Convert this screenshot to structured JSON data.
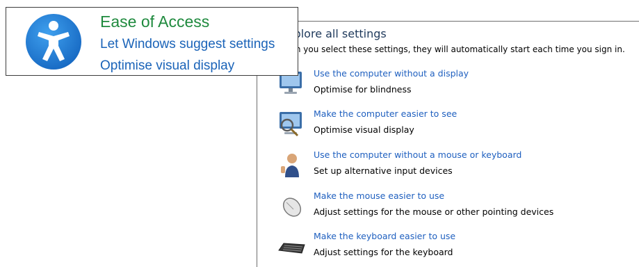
{
  "background_panel": {
    "heading": "Explore all settings",
    "subtitle": "When you select these settings, they will automatically start each time you sign in.",
    "items": [
      {
        "icon": "monitor-icon",
        "link": "Use the computer without a display",
        "description": "Optimise for blindness"
      },
      {
        "icon": "magnifier-monitor-icon",
        "link": "Make the computer easier to see",
        "description": "Optimise visual display"
      },
      {
        "icon": "person-icon",
        "link": "Use the computer without a mouse or keyboard",
        "description": "Set up alternative input devices"
      },
      {
        "icon": "mouse-icon",
        "link": "Make the mouse easier to use",
        "description": "Adjust settings for the mouse or other pointing devices"
      },
      {
        "icon": "keyboard-icon",
        "link": "Make the keyboard easier to use",
        "description": "Adjust settings for the keyboard"
      }
    ]
  },
  "card": {
    "icon": "ease-of-access-icon",
    "title": "Ease of Access",
    "suggestions": [
      "Let Windows suggest settings",
      "Optimise visual display"
    ]
  },
  "colors": {
    "title_green": "#1f8a3e",
    "link_blue": "#1a63b8",
    "icon_blue": "#1b7fd8"
  }
}
